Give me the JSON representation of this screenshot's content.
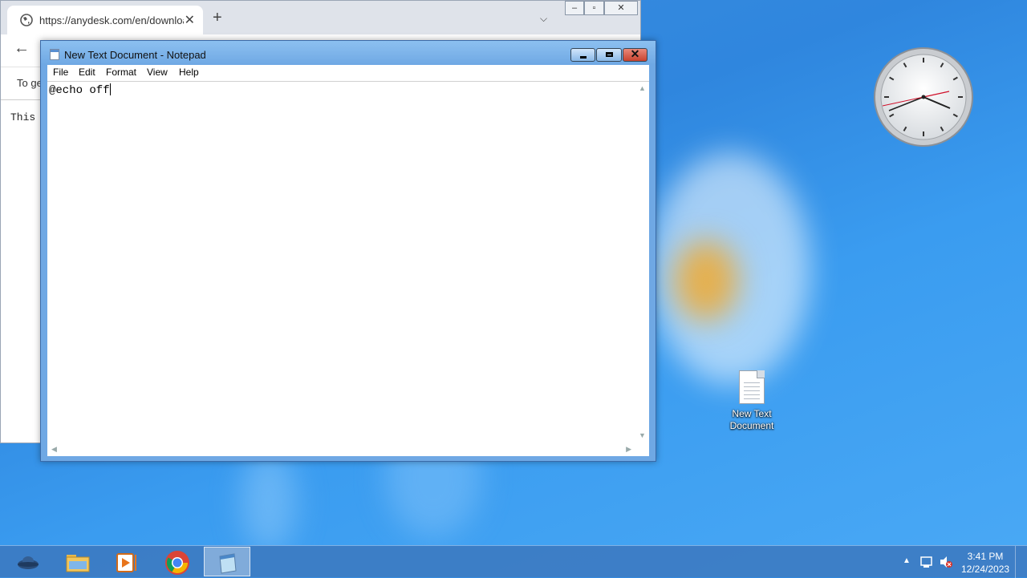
{
  "browser": {
    "tab_title": "https://anydesk.com/en/download",
    "infobar_text": "To ge",
    "page_text": "This w"
  },
  "notepad": {
    "title": "New Text Document - Notepad",
    "menu": [
      "File",
      "Edit",
      "Format",
      "View",
      "Help"
    ],
    "content": "@echo off"
  },
  "desktop": {
    "icon_label_line1": "New Text",
    "icon_label_line2": "Document"
  },
  "taskbar": {
    "apps": [
      "app-icon",
      "file-explorer-icon",
      "media-player-icon",
      "chrome-icon",
      "notepad-icon"
    ],
    "time": "3:41 PM",
    "date": "12/24/2023"
  },
  "colors": {
    "desktop_blue": "#2f86de",
    "notepad_frame": "#6fa8e4",
    "close_red": "#c8432f"
  }
}
